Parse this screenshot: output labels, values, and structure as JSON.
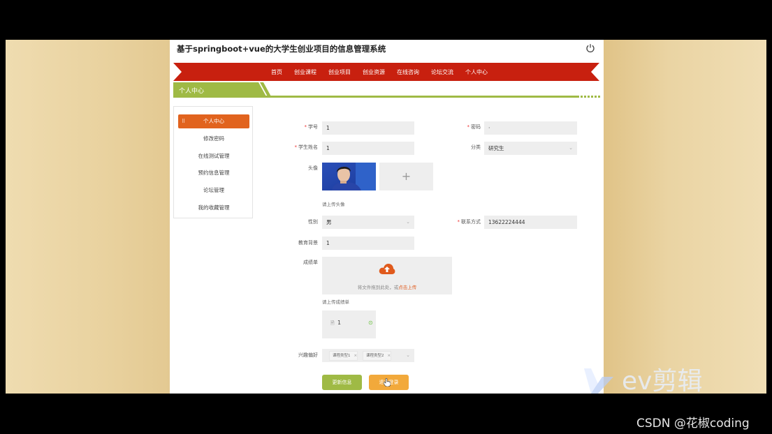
{
  "site": {
    "title": "基于springboot+vue的大学生创业项目的信息管理系统"
  },
  "nav": {
    "items": [
      {
        "label": "首页"
      },
      {
        "label": "创业课程"
      },
      {
        "label": "创业项目"
      },
      {
        "label": "创业资源"
      },
      {
        "label": "在线咨询"
      },
      {
        "label": "论坛交流"
      },
      {
        "label": "个人中心"
      }
    ],
    "active_index": 6
  },
  "section": {
    "title": "个人中心"
  },
  "side_menu": {
    "items": [
      {
        "label": "个人中心"
      },
      {
        "label": "修改密码"
      },
      {
        "label": "在线测试管理"
      },
      {
        "label": "预约信息管理"
      },
      {
        "label": "论坛管理"
      },
      {
        "label": "我的收藏管理"
      }
    ]
  },
  "form": {
    "student_id": {
      "label": "学号",
      "value": "1"
    },
    "password": {
      "label": "密码",
      "value": "·"
    },
    "student_name": {
      "label": "学生姓名",
      "value": "1"
    },
    "category": {
      "label": "分类",
      "value": "研究生"
    },
    "avatar": {
      "label": "头像",
      "hint": "请上传头像",
      "upload_symbol": "+"
    },
    "gender": {
      "label": "性别",
      "value": "男"
    },
    "contact": {
      "label": "联系方式",
      "value": "13622224444"
    },
    "education": {
      "label": "教育背景",
      "value": "1"
    },
    "transcript": {
      "label": "成绩单",
      "drop_text": "将文件拖到此处，或",
      "drop_link": "点击上传",
      "hint": "请上传成绩单",
      "file_name": "1"
    },
    "interests": {
      "label": "兴趣偏好",
      "tags": [
        "课程类型1",
        "课程类型2"
      ]
    }
  },
  "buttons": {
    "update": "更新信息",
    "logout": "退出登录"
  },
  "watermarks": {
    "editor": "ev剪辑",
    "csdn": "CSDN @花椒coding"
  },
  "colors": {
    "nav_red": "#c8200f",
    "accent_orange": "#e1631e",
    "accent_green": "#9fba45",
    "logout_orange": "#f2a93b"
  }
}
